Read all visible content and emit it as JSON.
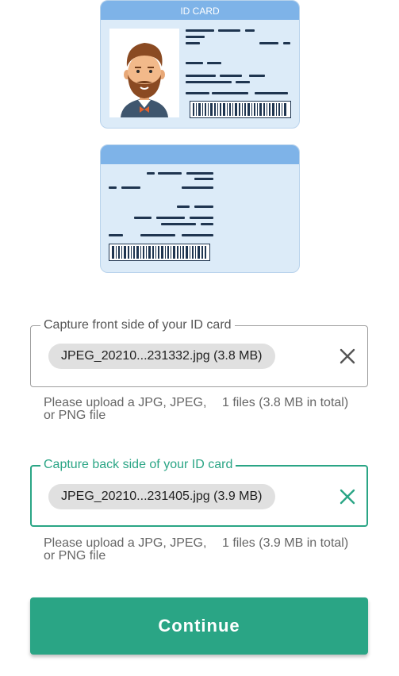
{
  "front_card": {
    "header": "ID CARD"
  },
  "front_upload": {
    "legend": "Capture front side of your ID card",
    "file_chip": "JPEG_20210...231332.jpg (3.8 MB)",
    "helper_left": "Please upload a JPG, JPEG, or PNG file",
    "helper_right": "1 files (3.8 MB in total)"
  },
  "back_upload": {
    "legend": "Capture back side of your ID card",
    "file_chip": "JPEG_20210...231405.jpg (3.9 MB)",
    "helper_left": "Please upload a JPG, JPEG, or PNG file",
    "helper_right": "1 files (3.9 MB in total)"
  },
  "continue_label": "Continue",
  "colors": {
    "accent": "#2aa585",
    "card_bg": "#dcebf8",
    "card_header": "#7eb3e8"
  }
}
